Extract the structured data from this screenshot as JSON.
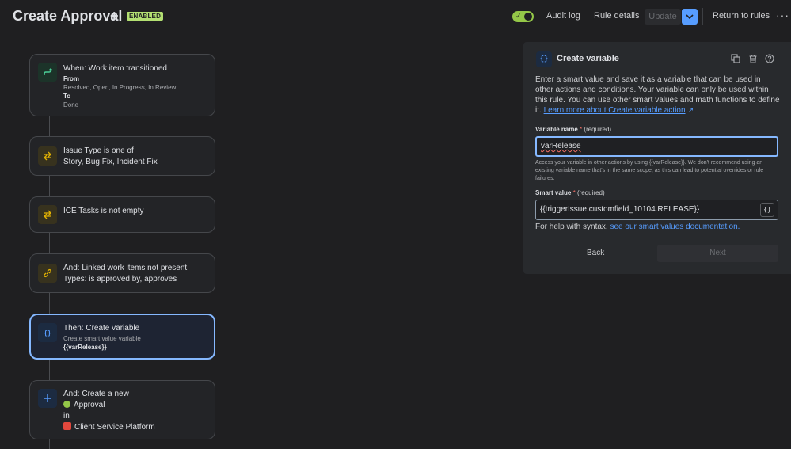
{
  "header": {
    "title": "Create Approval",
    "title_plus": "+",
    "status_badge": "ENABLED",
    "audit_log": "Audit log",
    "rule_details": "Rule details",
    "update": "Update",
    "return_to_rules": "Return to rules",
    "more": "···"
  },
  "rule": {
    "trigger": {
      "title": "When: Work item transitioned",
      "from_label": "From",
      "from_value": "Resolved, Open, In Progress, In Review",
      "to_label": "To",
      "to_value": "Done",
      "icon": "trigger-icon"
    },
    "condition1": {
      "line1": "Issue Type is one of",
      "line2": "Story, Bug Fix, Incident Fix",
      "icon": "condition-icon"
    },
    "condition2": {
      "line1": "ICE Tasks is not empty",
      "icon": "condition-icon"
    },
    "condition3": {
      "line1": "And: Linked work items not present",
      "line2": "Types: is approved by, approves",
      "icon": "link-icon"
    },
    "action1": {
      "title": "Then: Create variable",
      "sub": "Create smart value variable",
      "value": "{{varRelease}}",
      "icon": "braces-icon"
    },
    "action2": {
      "title": "And: Create a new",
      "item_type": "Approval",
      "in_label": "in",
      "project": "Client Service Platform",
      "icon": "plus-icon"
    }
  },
  "panel": {
    "title": "Create variable",
    "icon_glyph": "{}",
    "description": "Enter a smart value and save it as a variable that can be used in other actions and conditions. Your variable can only be used within this rule. You can use other smart values and math functions to define it. ",
    "learn_more": "Learn more about Create variable action",
    "variable_name_label": "Variable name",
    "required": "(required)",
    "variable_name_value": "varRelease",
    "hint": "Access your variable in other actions by using {{varRelease}}. We don't recommend using an existing variable name that's in the same scope, as this can lead to potential overrides or rule failures.",
    "smart_value_label": "Smart value",
    "smart_value_value": "{{triggerIssue.customfield_10104.RELEASE}}",
    "smart_value_button": "{}",
    "help_prefix": "For help with syntax, ",
    "help_link": "see our smart values documentation.",
    "back": "Back",
    "next": "Next"
  },
  "colors": {
    "accent": "#579dff",
    "enabled": "#b3df72",
    "toggle": "#94c748",
    "selected_border": "#85b8ff"
  }
}
